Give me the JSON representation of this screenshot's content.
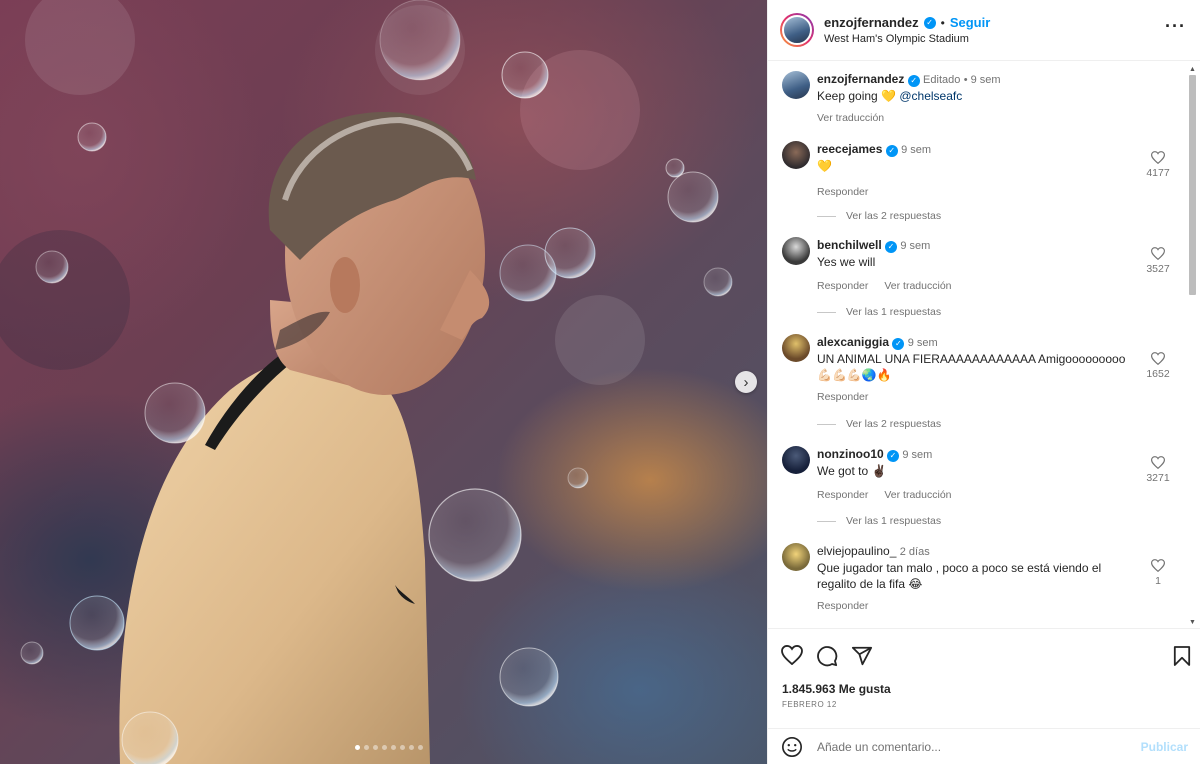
{
  "post": {
    "username": "enzojfernandez",
    "follow_label": "Seguir",
    "location": "West Ham's Olympic Stadium",
    "more_icon": "more-options-icon"
  },
  "caption": {
    "username": "enzojfernandez",
    "edited": "Editado",
    "time": "9 sem",
    "text": "Keep going 💛",
    "mention": "@chelseafc",
    "translate": "Ver traducción"
  },
  "comments": [
    {
      "username": "reecejames",
      "time": "9 sem",
      "text": "💛",
      "likes": "4177",
      "reply": "Responder",
      "translate": "",
      "replies": "Ver las 2 respuestas"
    },
    {
      "username": "benchilwell",
      "time": "9 sem",
      "text": "Yes we will",
      "likes": "3527",
      "reply": "Responder",
      "translate": "Ver traducción",
      "replies": "Ver las 1 respuestas"
    },
    {
      "username": "alexcaniggia",
      "time": "9 sem",
      "text": "UN ANIMAL UNA FIERAAAAAAAAAAAA Amigooooooooo 💪🏻💪🏻💪🏻🌏🔥",
      "likes": "1652",
      "reply": "Responder",
      "translate": "",
      "replies": "Ver las 2 respuestas"
    },
    {
      "username": "nonzinoo10",
      "time": "9 sem",
      "text": "We got to ✌🏿",
      "likes": "3271",
      "reply": "Responder",
      "translate": "Ver traducción",
      "replies": "Ver las 1 respuestas"
    },
    {
      "username": "elviejopaulino_",
      "time": "2 días",
      "text": "Que jugador tan malo , poco a poco se está viendo el regalito de la fifa 😂",
      "likes": "1",
      "reply": "Responder",
      "translate": "",
      "replies": ""
    }
  ],
  "footer": {
    "likes": "1.845.963 Me gusta",
    "date": "FEBRERO 12",
    "comment_placeholder": "Añade un comentario...",
    "publish_label": "Publicar"
  },
  "carousel": {
    "count": 8,
    "active_index": 0
  },
  "colors": {
    "accent": "#0095f6",
    "verified": "#0095f6",
    "publish_disabled": "#b2dffc"
  }
}
